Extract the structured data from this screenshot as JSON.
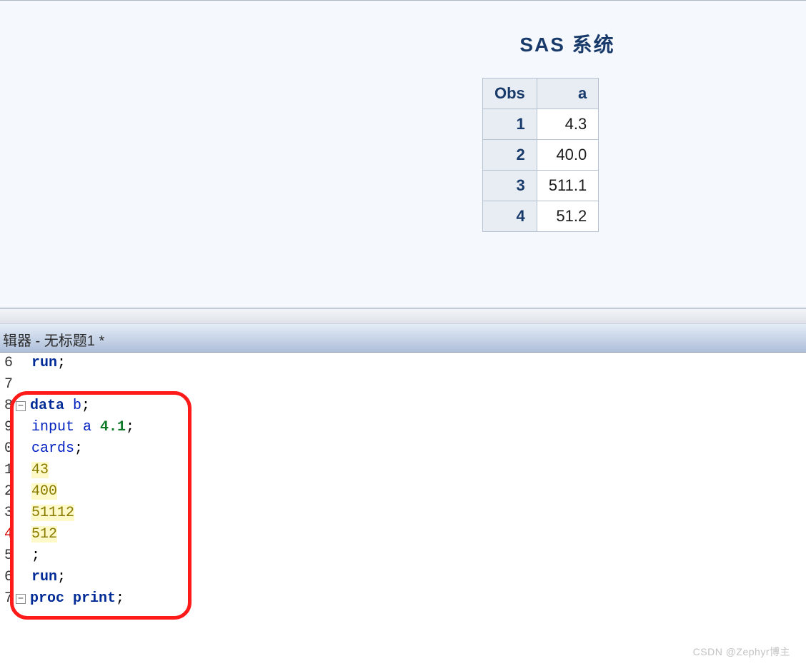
{
  "output": {
    "title": "SAS 系统",
    "columns": [
      "Obs",
      "a"
    ],
    "rows": [
      {
        "obs": "1",
        "a": "4.3"
      },
      {
        "obs": "2",
        "a": "40.0"
      },
      {
        "obs": "3",
        "a": "511.1"
      },
      {
        "obs": "4",
        "a": "51.2"
      }
    ]
  },
  "editor": {
    "title": "辑器 - 无标题1 *",
    "lines": [
      {
        "num": "6",
        "fold": null,
        "tokens": [
          {
            "t": "run",
            "c": "kw"
          },
          {
            "t": ";",
            "c": "semi"
          }
        ]
      },
      {
        "num": "7",
        "fold": null,
        "tokens": []
      },
      {
        "num": "8",
        "fold": "-",
        "tokens": [
          {
            "t": "data",
            "c": "kw"
          },
          {
            "t": " b",
            "c": "ident"
          },
          {
            "t": ";",
            "c": "semi"
          }
        ]
      },
      {
        "num": "9",
        "fold": null,
        "tokens": [
          {
            "t": "input",
            "c": "ident"
          },
          {
            "t": " a ",
            "c": "ident"
          },
          {
            "t": "4.1",
            "c": "fmt"
          },
          {
            "t": ";",
            "c": "semi"
          }
        ]
      },
      {
        "num": "0",
        "fold": null,
        "tokens": [
          {
            "t": "cards",
            "c": "ident"
          },
          {
            "t": ";",
            "c": "semi"
          }
        ]
      },
      {
        "num": "1",
        "fold": null,
        "tokens": [
          {
            "t": "43",
            "c": "data-lit"
          }
        ]
      },
      {
        "num": "2",
        "fold": null,
        "tokens": [
          {
            "t": "400",
            "c": "data-lit"
          }
        ]
      },
      {
        "num": "3",
        "fold": null,
        "tokens": [
          {
            "t": "51112",
            "c": "data-lit"
          }
        ]
      },
      {
        "num": "4",
        "red": true,
        "fold": null,
        "tokens": [
          {
            "t": "512",
            "c": "data-lit"
          }
        ]
      },
      {
        "num": "5",
        "fold": null,
        "tokens": [
          {
            "t": ";",
            "c": "semi"
          }
        ]
      },
      {
        "num": "6",
        "fold": null,
        "tokens": [
          {
            "t": "run",
            "c": "kw"
          },
          {
            "t": ";",
            "c": "semi"
          }
        ]
      },
      {
        "num": "7",
        "fold": "-",
        "tokens": [
          {
            "t": "proc print",
            "c": "kw"
          },
          {
            "t": ";",
            "c": "semi"
          }
        ]
      }
    ]
  },
  "watermark": "CSDN @Zephyr博主"
}
